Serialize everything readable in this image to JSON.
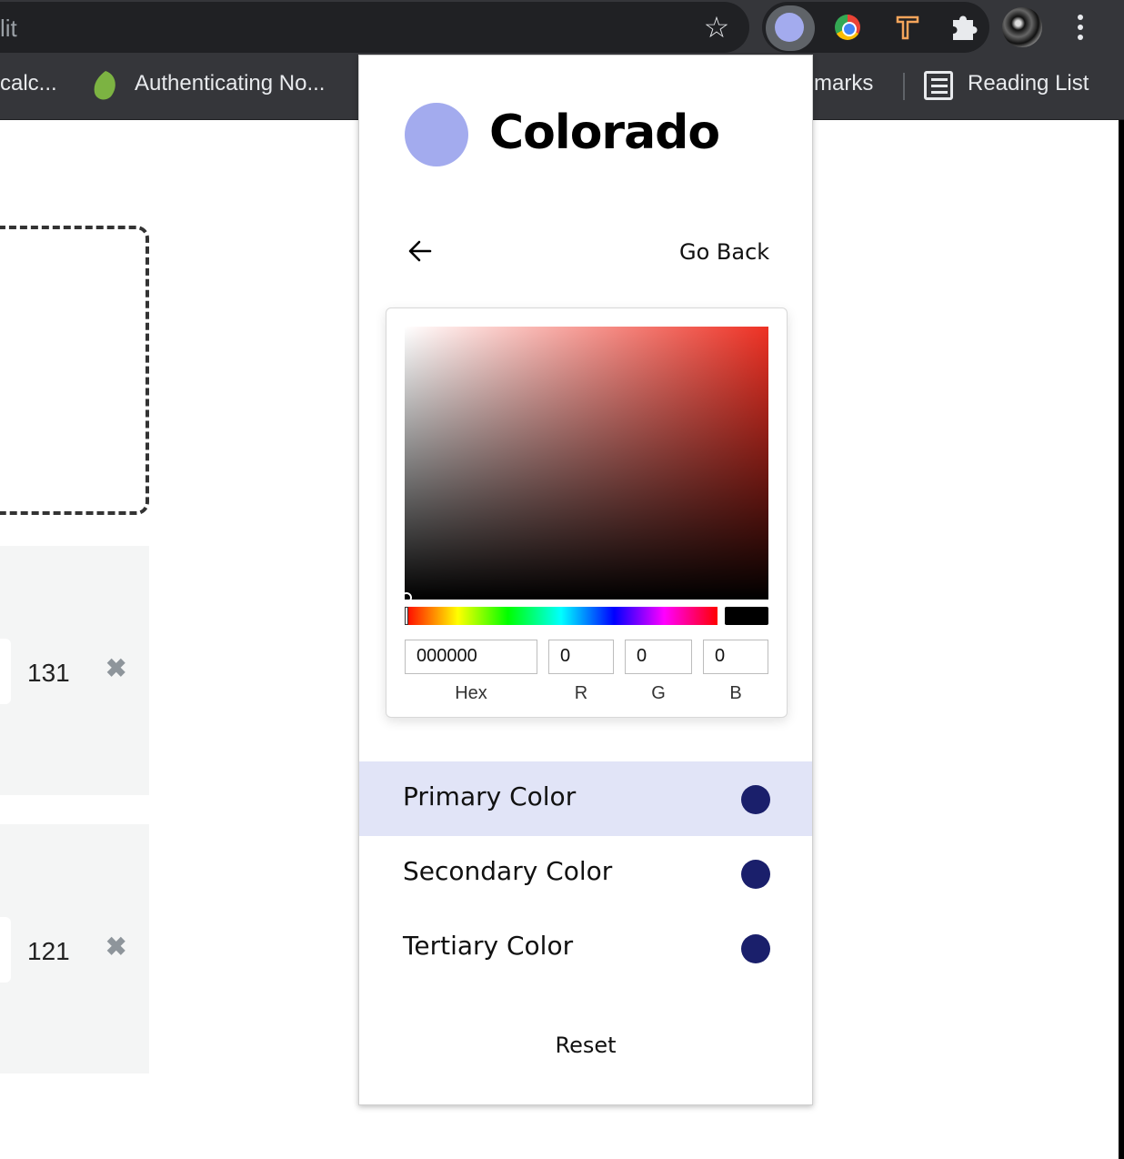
{
  "browser": {
    "omnibox_text": "lit",
    "bookmarks": {
      "item1_label": "calc...",
      "item2_label": "Authenticating No...",
      "item3_label": "marks",
      "reading_list_label": "Reading List"
    },
    "icons": [
      "star-icon",
      "colorado-extension-icon",
      "chrome-extension-icon",
      "hammer-extension-icon",
      "puzzle-icon",
      "profile-avatar",
      "kebab-menu-icon",
      "evernote-leaf-icon",
      "reading-list-icon"
    ]
  },
  "background_page": {
    "card1_value": "131",
    "card2_value": "121",
    "remove_symbol": "✖"
  },
  "popup": {
    "app_name": "Colorado",
    "logo_color": "#a3abee",
    "go_back_label": "Go Back",
    "picker": {
      "hue_color": "#ee3124",
      "hex_value": "000000",
      "r_value": "0",
      "g_value": "0",
      "b_value": "0",
      "hex_label": "Hex",
      "r_label": "R",
      "g_label": "G",
      "b_label": "B",
      "swatch_color": "#000000"
    },
    "colors": [
      {
        "label": "Primary Color",
        "value": "#1a1f6b",
        "active": true
      },
      {
        "label": "Secondary Color",
        "value": "#1a1f6b",
        "active": false
      },
      {
        "label": "Tertiary Color",
        "value": "#1a1f6b",
        "active": false
      }
    ],
    "reset_label": "Reset"
  }
}
